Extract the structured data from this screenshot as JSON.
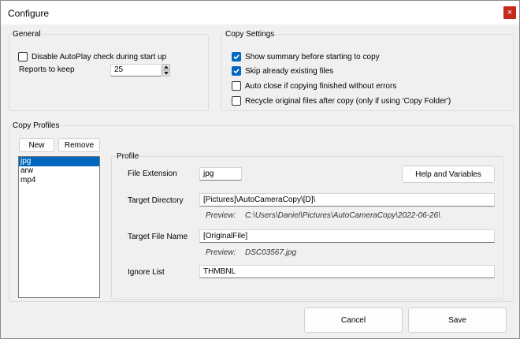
{
  "window": {
    "title": "Configure",
    "close_glyph": "×"
  },
  "general": {
    "label": "General",
    "disable_autoplay": {
      "label": "Disable AutoPlay check during start up",
      "checked": false
    },
    "reports_label": "Reports to keep",
    "reports_value": "25"
  },
  "copy_settings": {
    "label": "Copy Settings",
    "options": [
      {
        "label": "Show summary before starting to copy",
        "checked": true
      },
      {
        "label": "Skip already existing files",
        "checked": true
      },
      {
        "label": "Auto close if copying finished without errors",
        "checked": false
      },
      {
        "label": "Recycle original files after copy (only if using 'Copy Folder')",
        "checked": false
      }
    ]
  },
  "copy_profiles": {
    "label": "Copy Profiles",
    "new_label": "New",
    "remove_label": "Remove",
    "items": [
      "jpg",
      "arw",
      "mp4"
    ],
    "selected_index": 0
  },
  "profile": {
    "label": "Profile",
    "file_extension_label": "File Extension",
    "file_extension_value": "jpg",
    "help_label": "Help and Variables",
    "target_dir_label": "Target Directory",
    "target_dir_value": "[Pictures]\\AutoCameraCopy\\[D]\\",
    "preview_label": "Preview:",
    "target_dir_preview": "C:\\Users\\Daniel\\Pictures\\AutoCameraCopy\\2022-06-26\\",
    "target_file_label": "Target File Name",
    "target_file_value": "[OriginalFile]",
    "target_file_preview": "DSC03567.jpg",
    "ignore_label": "Ignore List",
    "ignore_value": "THMBNL"
  },
  "footer": {
    "cancel_label": "Cancel",
    "save_label": "Save"
  },
  "colors": {
    "accent": "#0067c0",
    "close": "#c42b1c"
  }
}
